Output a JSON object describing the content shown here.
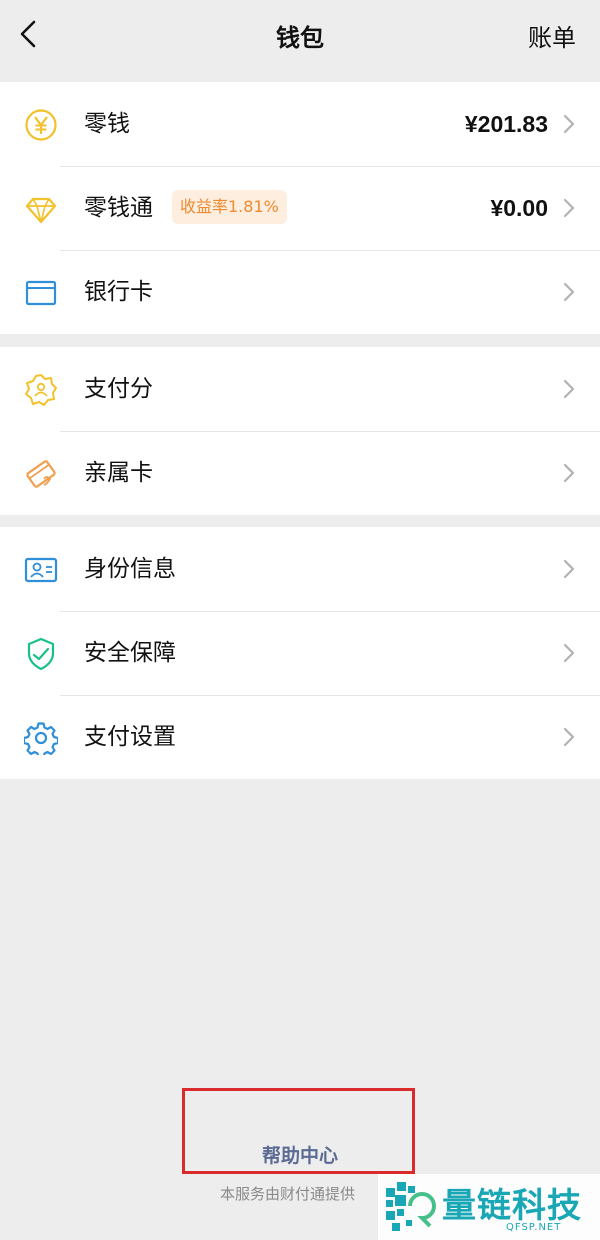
{
  "header": {
    "title": "钱包",
    "bill_label": "账单"
  },
  "sections": [
    {
      "items": [
        {
          "label": "零钱",
          "amount": "¥201.83",
          "icon": "yen-coin-icon"
        },
        {
          "label": "零钱通",
          "badge": "收益率1.81%",
          "amount": "¥0.00",
          "icon": "diamond-icon"
        },
        {
          "label": "银行卡",
          "icon": "bank-card-icon"
        }
      ]
    },
    {
      "items": [
        {
          "label": "支付分",
          "icon": "pay-score-icon"
        },
        {
          "label": "亲属卡",
          "icon": "family-card-icon"
        }
      ]
    },
    {
      "items": [
        {
          "label": "身份信息",
          "icon": "id-card-icon"
        },
        {
          "label": "安全保障",
          "icon": "shield-check-icon"
        },
        {
          "label": "支付设置",
          "icon": "gear-icon"
        }
      ]
    }
  ],
  "footer": {
    "help_label": "帮助中心",
    "provider_note": "本服务由财付通提供"
  },
  "watermark": {
    "text_cn": "量链科技",
    "text_en": "QFSP.NET"
  },
  "colors": {
    "background": "#ededed",
    "yellow_icon": "#f3c12c",
    "orange_icon": "#f0a050",
    "blue_icon": "#2f8fd8",
    "green_icon": "#19c08a",
    "badge_bg": "#fdeee0",
    "badge_text": "#f08a2e",
    "help_link": "#5b6b94",
    "highlight_box": "#d92b2b",
    "watermark": "#1aa7b5"
  }
}
